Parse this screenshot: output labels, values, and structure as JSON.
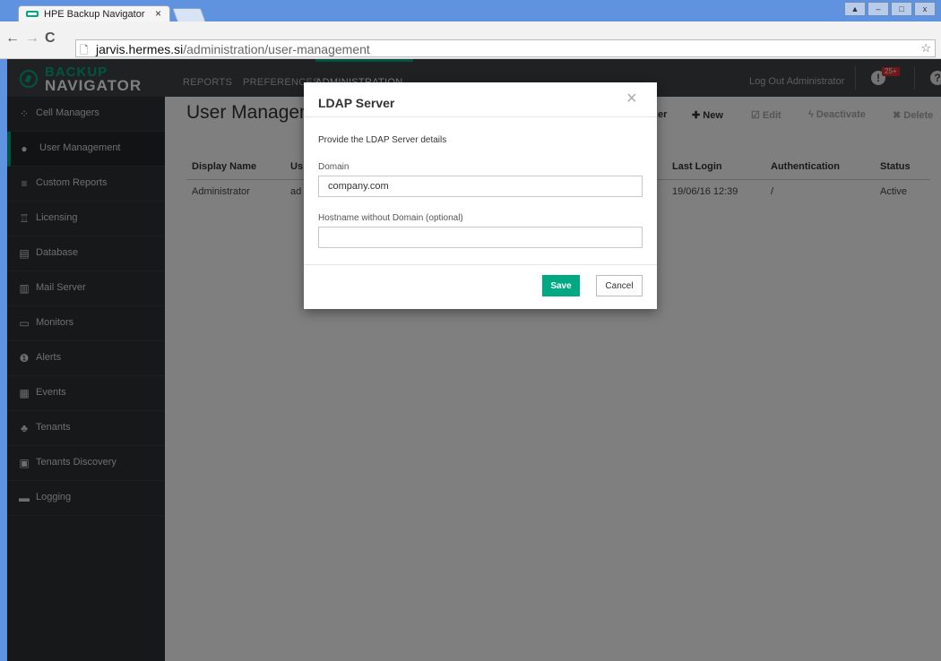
{
  "browser": {
    "tab_title": "HPE Backup Navigator",
    "tab_close": "×",
    "back": "←",
    "forward": "→",
    "reload": "C",
    "url_host": "jarvis.hermes.si",
    "url_path": "/administration/user-management",
    "window_controls": [
      "▲",
      "–",
      "□",
      "x"
    ]
  },
  "app": {
    "logo_top": "BACKUP",
    "logo_bottom": "NAVIGATOR",
    "menu": [
      "REPORTS",
      "PREFERENCES",
      "ADMINISTRATION"
    ],
    "logout": "Log Out Administrator",
    "alert_badge": "25+",
    "accent_color": "#00a982"
  },
  "sidebar": {
    "items": [
      {
        "label": "Cell Managers",
        "icon": "cells-icon"
      },
      {
        "label": "User Management",
        "icon": "user-icon"
      },
      {
        "label": "Custom Reports",
        "icon": "custom-reports-icon"
      },
      {
        "label": "Licensing",
        "icon": "license-icon"
      },
      {
        "label": "Database",
        "icon": "database-icon"
      },
      {
        "label": "Mail Server",
        "icon": "mail-server-icon"
      },
      {
        "label": "Monitors",
        "icon": "monitor-icon"
      },
      {
        "label": "Alerts",
        "icon": "alert-icon"
      },
      {
        "label": "Events",
        "icon": "calendar-icon"
      },
      {
        "label": "Tenants",
        "icon": "users-icon"
      },
      {
        "label": "Tenants Discovery",
        "icon": "list-icon"
      },
      {
        "label": "Logging",
        "icon": "log-icon"
      }
    ]
  },
  "main": {
    "title": "User Management",
    "actions": {
      "partial": "er",
      "new": "New",
      "edit": "Edit",
      "deactivate": "Deactivate",
      "delete": "Delete"
    },
    "columns": [
      "Display Name",
      "Us",
      "Last Login",
      "Authentication",
      "Status"
    ],
    "rows": [
      {
        "display_name": "Administrator",
        "user": "ad",
        "last_login": "19/06/16 12:39",
        "auth": "/",
        "status": "Active"
      }
    ]
  },
  "modal": {
    "title": "LDAP Server",
    "close": "×",
    "description": "Provide the LDAP Server details",
    "domain_label": "Domain",
    "domain_value": "company.com",
    "hostname_label": "Hostname without Domain (optional)",
    "hostname_value": "",
    "save": "Save",
    "cancel": "Cancel"
  }
}
